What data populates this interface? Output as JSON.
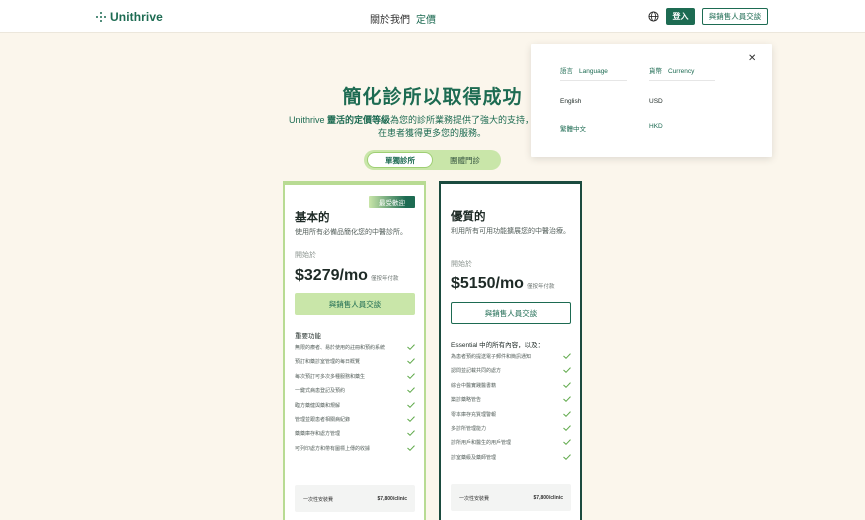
{
  "header": {
    "logo_text": "Unithrive",
    "nav": {
      "about": "關於我們",
      "pricing": "定價"
    },
    "globe_icon": "globe-icon",
    "login": "登入",
    "contact_sales": "與銷售人員交談"
  },
  "hero": {
    "title": "簡化診所以取得成功",
    "sub_prefix": "Unithrive ",
    "sub_bold": "靈活的定價等級",
    "sub_rest": "為您的診所業務提供了強大的支持，",
    "sub_line2": "在患者獲得更多您的服務。"
  },
  "toggle": {
    "single": "單獨診所",
    "group": "團體門診"
  },
  "plans": {
    "basic": {
      "badge": "最受歡迎",
      "name": "基本的",
      "desc": "使用所有必備品簡化您的中醫診所。",
      "from": "開始於",
      "price": "$3279/mo",
      "billing": "僅按年付款",
      "cta": "與銷售人員交談",
      "feature_header": "重要功能",
      "features": [
        "無限的療者、易於使用的註冊和預約系統",
        "預訂和藥診室管理的每日概覽",
        "每次預訂可多次多種服務和藥生",
        "一鍵式病患登記及預約",
        "臨方藥健與藥和規解",
        "管理並跟患者相關病紀錄",
        "藥藥庫存和處方管理",
        "可列印處方和帶有圖標上傳的收據"
      ],
      "fee_label": "一次性安裝費",
      "fee_value": "$7,800/clinic"
    },
    "premium": {
      "name": "優質的",
      "desc": "利用所有可用功能擴展您的中醫治療。",
      "from": "開始於",
      "price": "$5150/mo",
      "billing": "僅按年付款",
      "cta": "與銷售人員交談",
      "feature_header": "Essential 中的所有內容，以及：",
      "features": [
        "為患者預約提送電子郵件和簡訊通知",
        "認問並記載共同的處方",
        "綜合中醫實踐醫書籍",
        "築診藥略管告",
        "零本庫存充質理警報",
        "多診所管理能力",
        "診所用戶和醫生的用戶管理",
        "診室藥級及藥師管理"
      ],
      "fee_label": "一次性安裝費",
      "fee_value": "$7,800/clinic"
    }
  },
  "dropdown": {
    "language_zh": "語言",
    "language_en": "Language",
    "currency_zh": "貨幣",
    "currency_en": "Currency",
    "lang_options": [
      "English",
      "繁體中文"
    ],
    "currency_options": [
      "USD",
      "HKD"
    ],
    "close_icon": "close-icon"
  },
  "colors": {
    "brand": "#1d6b52",
    "accent_light": "#c9e6a9",
    "background": "#fbf6ec"
  }
}
